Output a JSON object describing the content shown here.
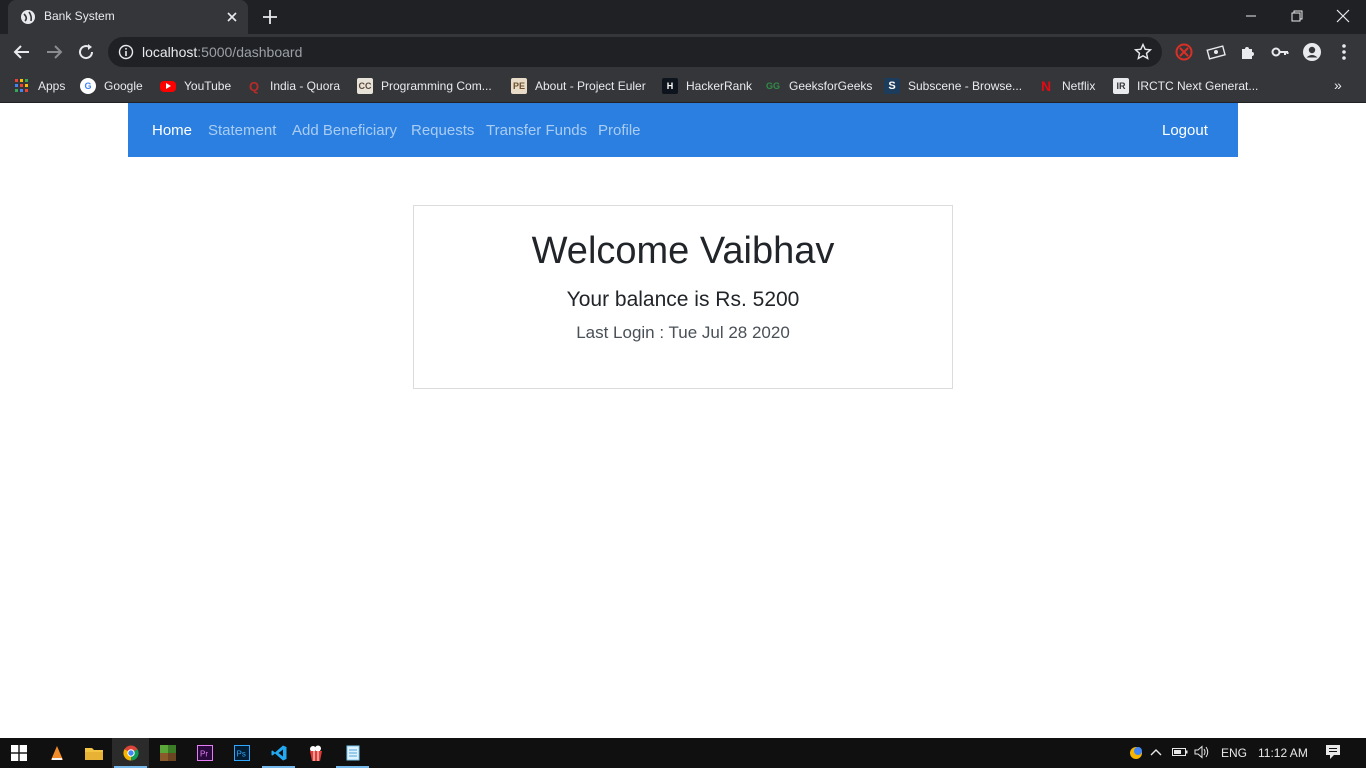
{
  "browser": {
    "tab_title": "Bank System",
    "url_host": "localhost",
    "url_rest": ":5000/dashboard",
    "bookmarks": [
      {
        "label": "Apps",
        "icon": "apps-grid-icon",
        "color": "#e94235"
      },
      {
        "label": "Google",
        "icon": "google-icon",
        "color": "#4285f4"
      },
      {
        "label": "YouTube",
        "icon": "youtube-icon",
        "color": "#ff0000"
      },
      {
        "label": "India - Quora",
        "icon": "quora-icon",
        "color": "#b92b27"
      },
      {
        "label": "Programming Com...",
        "icon": "codechef-icon",
        "color": "#5b4638"
      },
      {
        "label": "About - Project Euler",
        "icon": "project-euler-icon",
        "color": "#6b4f2f"
      },
      {
        "label": "HackerRank",
        "icon": "hackerrank-icon",
        "color": "#1ba94c"
      },
      {
        "label": "GeeksforGeeks",
        "icon": "geeksforgeeks-icon",
        "color": "#2f8d46"
      },
      {
        "label": "Subscene - Browse...",
        "icon": "subscene-icon",
        "color": "#2d6a9f"
      },
      {
        "label": "Netflix",
        "icon": "netflix-icon",
        "color": "#e50914"
      },
      {
        "label": "IRCTC Next Generat...",
        "icon": "irctc-icon",
        "color": "#cccccc"
      }
    ]
  },
  "nav": {
    "home": "Home",
    "statement": "Statement",
    "add_beneficiary": "Add Beneficiary",
    "requests": "Requests",
    "transfer_funds": "Transfer Funds",
    "profile": "Profile",
    "logout": "Logout"
  },
  "dashboard": {
    "welcome": "Welcome Vaibhav",
    "balance": "Your balance is Rs. 5200",
    "last_login": "Last Login : Tue Jul 28 2020"
  },
  "taskbar": {
    "language": "ENG",
    "time": "11:12 AM"
  },
  "colors": {
    "navbar": "#2a7fe0",
    "chrome_dark": "#202124",
    "chrome_toolbar": "#35363a"
  }
}
